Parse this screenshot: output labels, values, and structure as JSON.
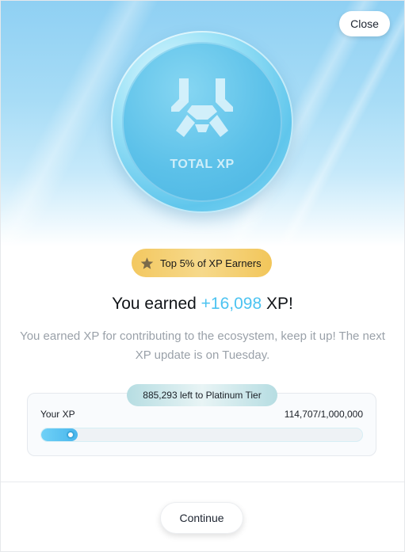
{
  "modal": {
    "close_label": "Close",
    "coin": {
      "text": "TOTAL XP",
      "icon": "total-xp-logo-icon"
    },
    "badge": {
      "icon": "star-icon",
      "label": "Top 5% of XP Earners"
    },
    "headline": {
      "prefix": "You earned ",
      "amount": "+16,098",
      "suffix": " XP!"
    },
    "subtitle": "You earned XP for contributing to the ecosystem, keep it up! The next XP update is on Tuesday.",
    "progress": {
      "tier_pill": "885,293 left to Platinum Tier",
      "label": "Your XP",
      "values": "114,707/1,000,000",
      "current": 114707,
      "max": 1000000
    },
    "continue_label": "Continue"
  },
  "colors": {
    "accent": "#4cc3f1",
    "badge_gold": "#f3c860",
    "hero_blue": "#8fd0f3"
  }
}
